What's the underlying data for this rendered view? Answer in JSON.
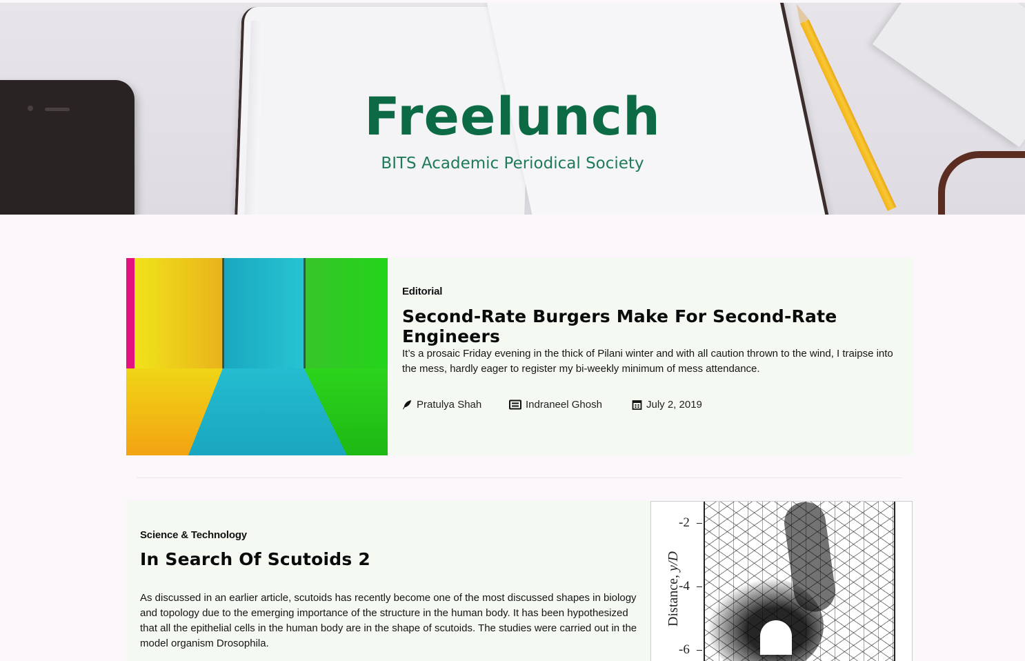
{
  "site": {
    "title": "Freelunch",
    "subtitle": "BITS Academic Periodical Society"
  },
  "articles": [
    {
      "category": "Editorial",
      "title": "Second-Rate Burgers Make For Second-Rate Engineers",
      "excerpt": "It’s a prosaic Friday evening in the thick of Pilani winter and with all caution thrown to the wind, I traipse into the mess, hardly eager to register my bi-weekly minimum of mess attendance.",
      "author": "Pratulya Shah",
      "editor": "Indraneel Ghosh",
      "date": "July 2, 2019",
      "icons": {
        "author": "feather-icon",
        "editor": "newspaper-icon",
        "date": "calendar-icon"
      }
    },
    {
      "category": "Science & Technology",
      "title": "In Search Of Scutoids 2",
      "excerpt": "As discussed in an earlier article, scutoids has recently become one of the most discussed shapes in biology and topology due to the emerging importance of the structure in the human body. It has been hypothesized that all the epithelial cells in the human body are in the shape of scutoids. The studies were carried out in the model organism Drosophila.",
      "figure": {
        "axis_label_prefix": "Distance, ",
        "axis_label_var": "y/D",
        "ticks": [
          "-2",
          "-4",
          "-6"
        ]
      }
    }
  ],
  "colors": {
    "brand": "#0c6b45",
    "card_bg": "#f4f9f2",
    "page_bg": "#fbf7fa"
  }
}
